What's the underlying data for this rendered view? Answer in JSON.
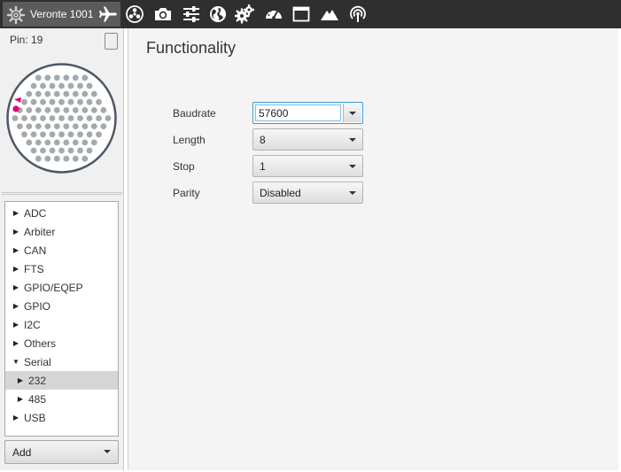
{
  "app": {
    "title": "Veronte 1001",
    "toolbar_icons": [
      "airplane-icon",
      "radiation-icon",
      "camera-icon",
      "sliders-icon",
      "globe-icon",
      "gears-icon",
      "gauge-icon",
      "window-icon",
      "mountain-icon",
      "antenna-icon"
    ]
  },
  "left": {
    "pin_label": "Pin: 19",
    "connector": {
      "selected_pin_color": "#e0007a",
      "pin_color": "#a4aaac"
    },
    "tree": [
      {
        "label": "ADC",
        "expanded": false
      },
      {
        "label": "Arbiter",
        "expanded": false
      },
      {
        "label": "CAN",
        "expanded": false
      },
      {
        "label": "FTS",
        "expanded": false
      },
      {
        "label": "GPIO/EQEP",
        "expanded": false
      },
      {
        "label": "GPIO",
        "expanded": false
      },
      {
        "label": "I2C",
        "expanded": false
      },
      {
        "label": "Others",
        "expanded": false
      },
      {
        "label": "Serial",
        "expanded": true
      },
      {
        "label": "232",
        "expanded": false,
        "child": true,
        "selected": true
      },
      {
        "label": "485",
        "expanded": false,
        "child": true
      },
      {
        "label": "USB",
        "expanded": false
      }
    ],
    "add_label": "Add"
  },
  "main": {
    "title": "Functionality",
    "baudrate": {
      "label": "Baudrate",
      "value": "57600"
    },
    "length": {
      "label": "Length",
      "value": "8"
    },
    "stop": {
      "label": "Stop",
      "value": "1"
    },
    "parity": {
      "label": "Parity",
      "value": "Disabled"
    }
  },
  "colors": {
    "toolbar_bg": "#2f2f2f",
    "focus_blue": "#3a9ad9",
    "selected_row": "#d6d6d6"
  }
}
